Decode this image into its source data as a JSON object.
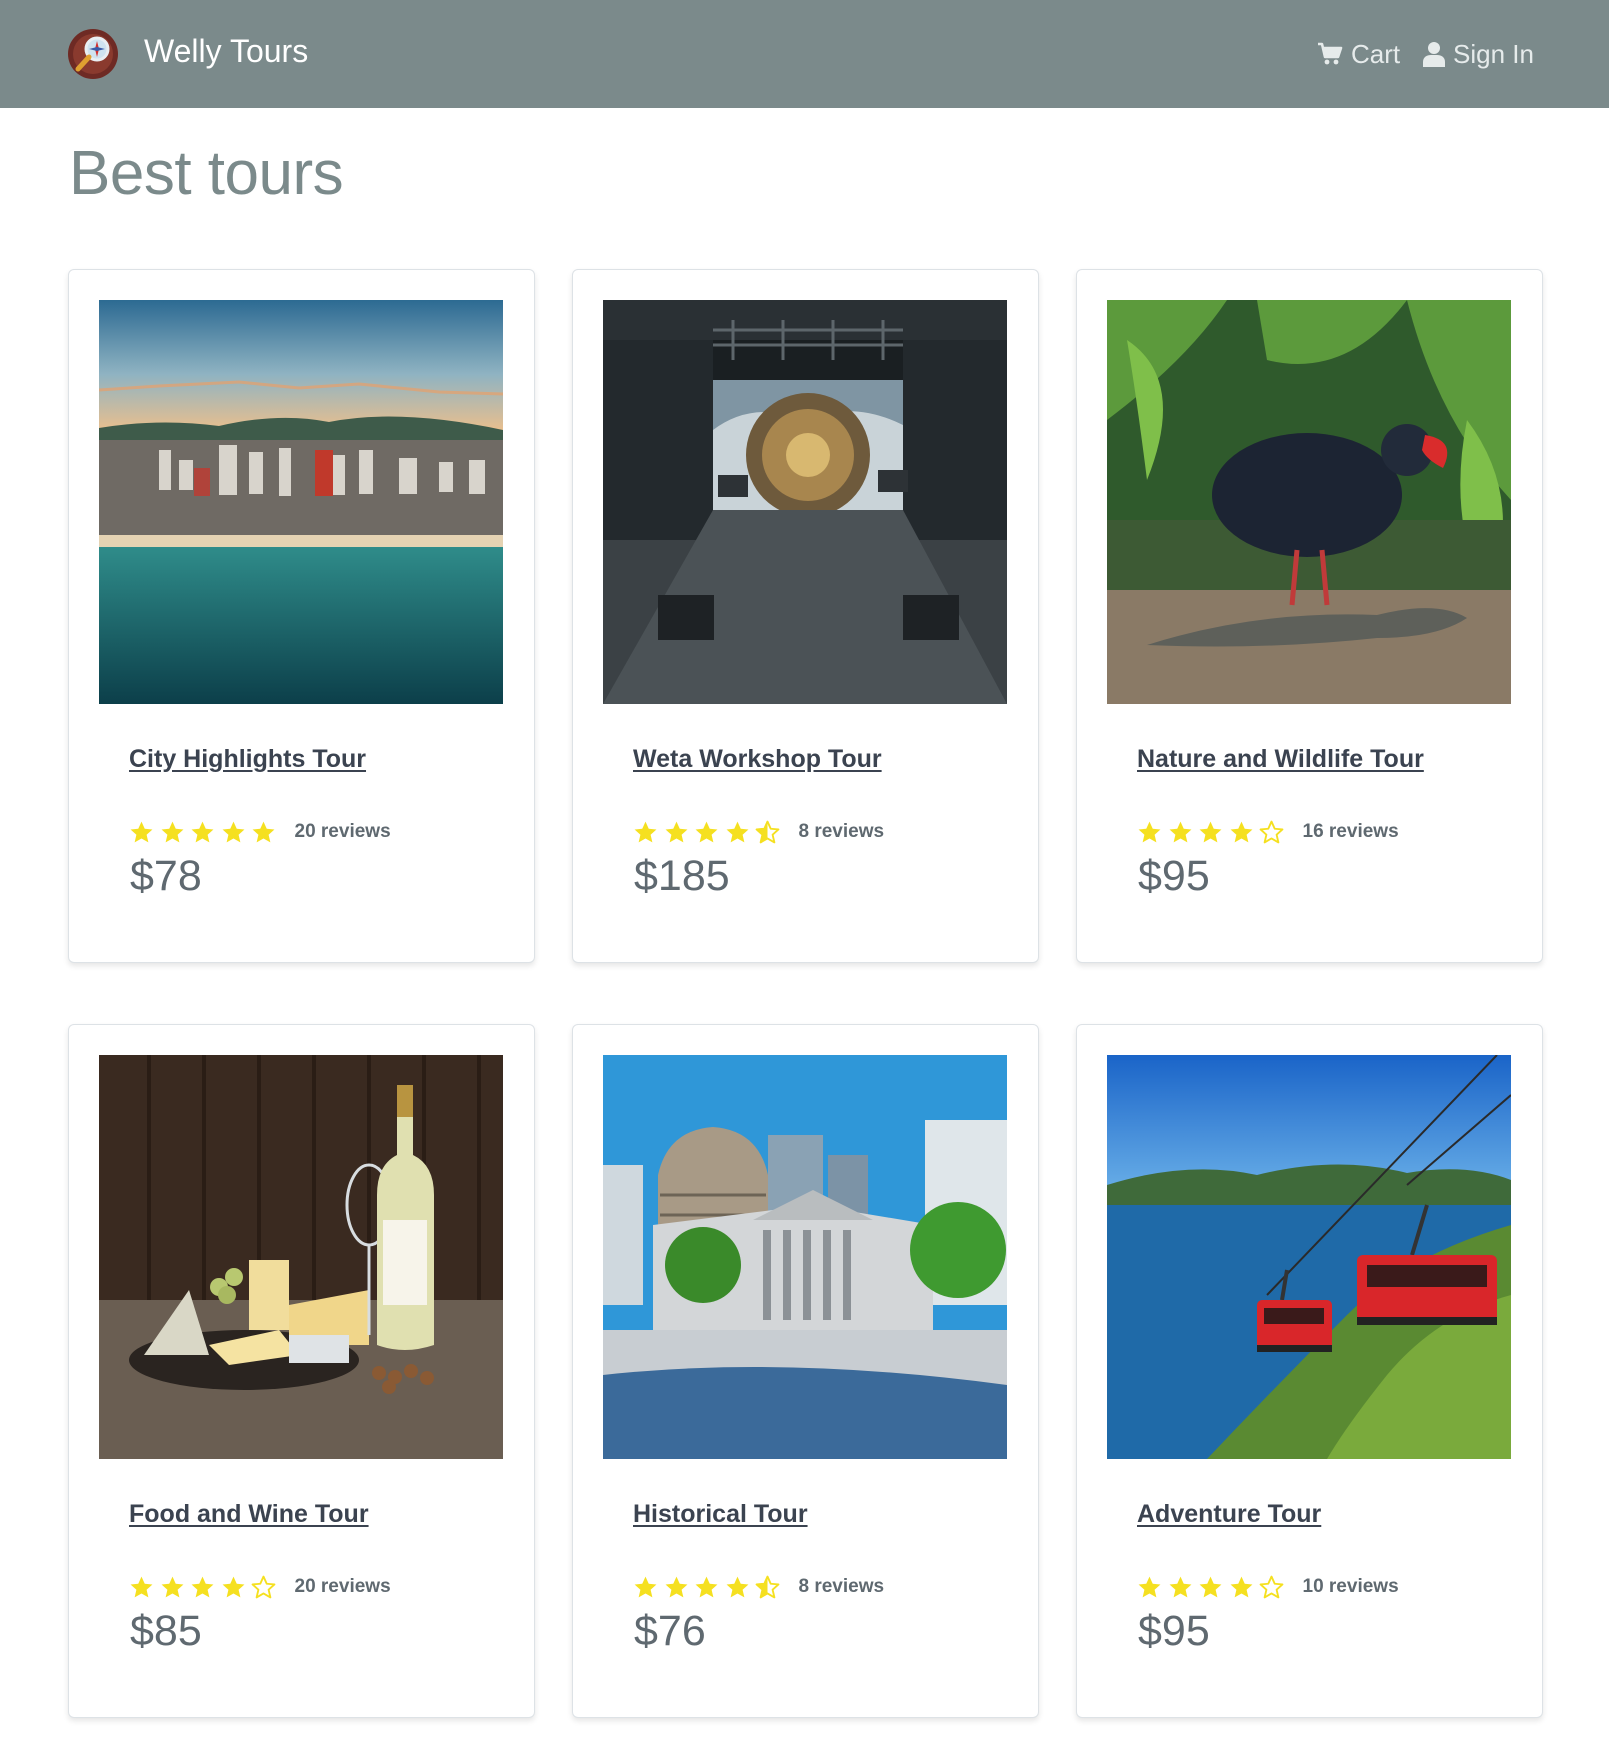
{
  "navbar": {
    "brand": "Welly Tours",
    "cart_label": "Cart",
    "signin_label": "Sign In",
    "background": "#7b8a8b"
  },
  "page": {
    "title": "Best tours"
  },
  "colors": {
    "star": "#f5e020",
    "link": "#3b4350",
    "muted": "#5f6970"
  },
  "tours": [
    {
      "name": "City Highlights Tour",
      "rating": 5,
      "reviews": "20 reviews",
      "price": "$78",
      "image": "wellington-city-aerial"
    },
    {
      "name": "Weta Workshop Tour",
      "rating": 4.5,
      "reviews": "8 reviews",
      "price": "$185",
      "image": "film-studio-stage"
    },
    {
      "name": "Nature and Wildlife Tour",
      "rating": 4,
      "reviews": "16 reviews",
      "price": "$95",
      "image": "takahe-and-tuatara"
    },
    {
      "name": "Food and Wine Tour",
      "rating": 4,
      "reviews": "20 reviews",
      "price": "$85",
      "image": "cheese-and-wine"
    },
    {
      "name": "Historical Tour",
      "rating": 4.5,
      "reviews": "8 reviews",
      "price": "$76",
      "image": "beehive-parliament"
    },
    {
      "name": "Adventure Tour",
      "rating": 4,
      "reviews": "10 reviews",
      "price": "$95",
      "image": "cable-car-harbour"
    }
  ]
}
